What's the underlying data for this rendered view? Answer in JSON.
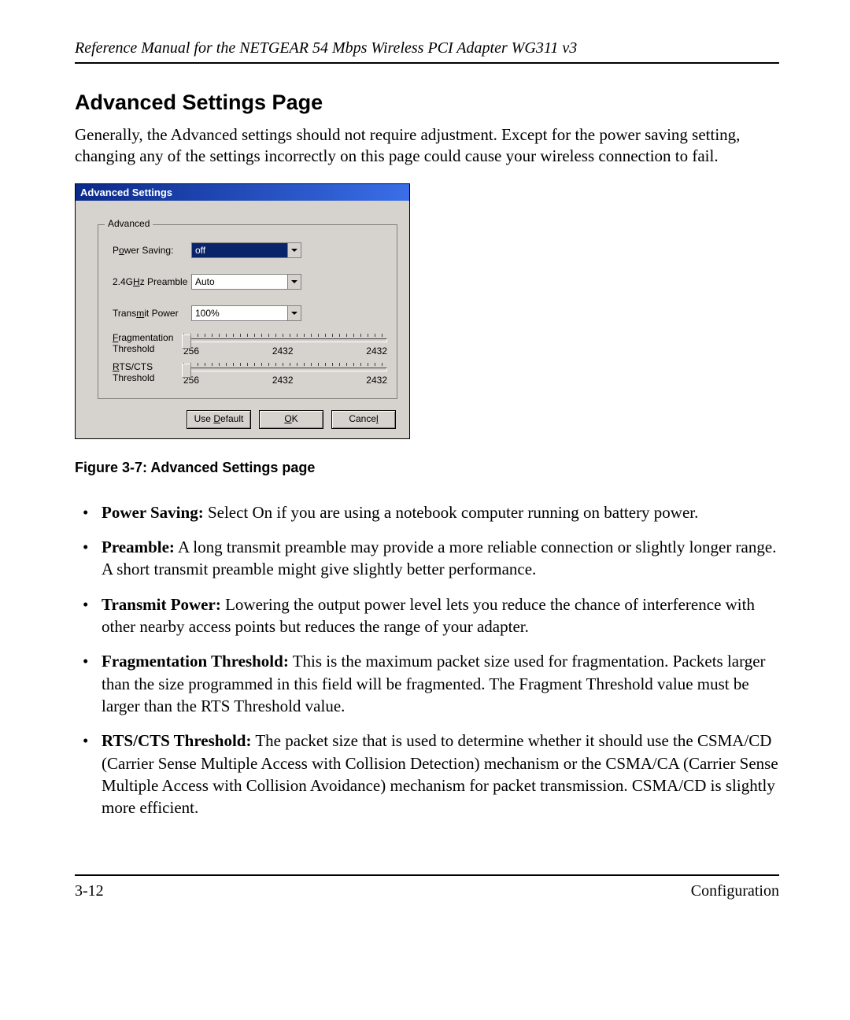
{
  "header": "Reference Manual for the NETGEAR 54 Mbps Wireless PCI Adapter WG311 v3",
  "section_title": "Advanced Settings Page",
  "intro": "Generally, the Advanced settings should not require adjustment. Except for the power saving setting, changing any of the settings incorrectly on this page could cause your wireless connection to fail.",
  "dialog": {
    "title": "Advanced Settings",
    "group_title": "Advanced",
    "power_saving": {
      "label": "Power Saving:",
      "value": "off"
    },
    "preamble": {
      "label": "2.4GHz Preamble",
      "value": "Auto"
    },
    "transmit_power": {
      "label": "Transmit Power",
      "value": "100%"
    },
    "frag": {
      "label": "Fragmentation Threshold",
      "min": "256",
      "mid": "2432",
      "max": "2432"
    },
    "rtscts": {
      "label": "RTS/CTS Threshold",
      "min": "256",
      "mid": "2432",
      "max": "2432"
    },
    "buttons": {
      "use_default": "Use Default",
      "ok": "OK",
      "cancel": "Cancel"
    }
  },
  "figure_caption": "Figure 3-7:  Advanced Settings page",
  "defs": {
    "power_saving": {
      "term": "Power Saving:",
      "text": " Select On if you are using a notebook computer running on battery power."
    },
    "preamble": {
      "term": "Preamble:",
      "text": " A long transmit preamble may provide a more reliable connection or slightly longer range.  A short transmit preamble might give slightly better performance."
    },
    "transmit_power": {
      "term": "Transmit Power:",
      "text": " Lowering the output power level lets you reduce the chance of interference with other nearby access points but reduces the range of your adapter."
    },
    "frag": {
      "term": "Fragmentation Threshold:",
      "text": " This is the maximum packet size used for fragmentation. Packets larger than the size programmed in this field will be fragmented. The Fragment Threshold value must be larger than the RTS Threshold value."
    },
    "rtscts": {
      "term": "RTS/CTS Threshold:",
      "text": " The packet size that is used to determine whether it should use the CSMA/CD (Carrier Sense Multiple Access with Collision Detection) mechanism or the CSMA/CA (Carrier Sense Multiple Access with Collision Avoidance) mechanism for packet transmission. CSMA/CD is slightly more efficient."
    }
  },
  "footer": {
    "page": "3-12",
    "section": "Configuration"
  }
}
